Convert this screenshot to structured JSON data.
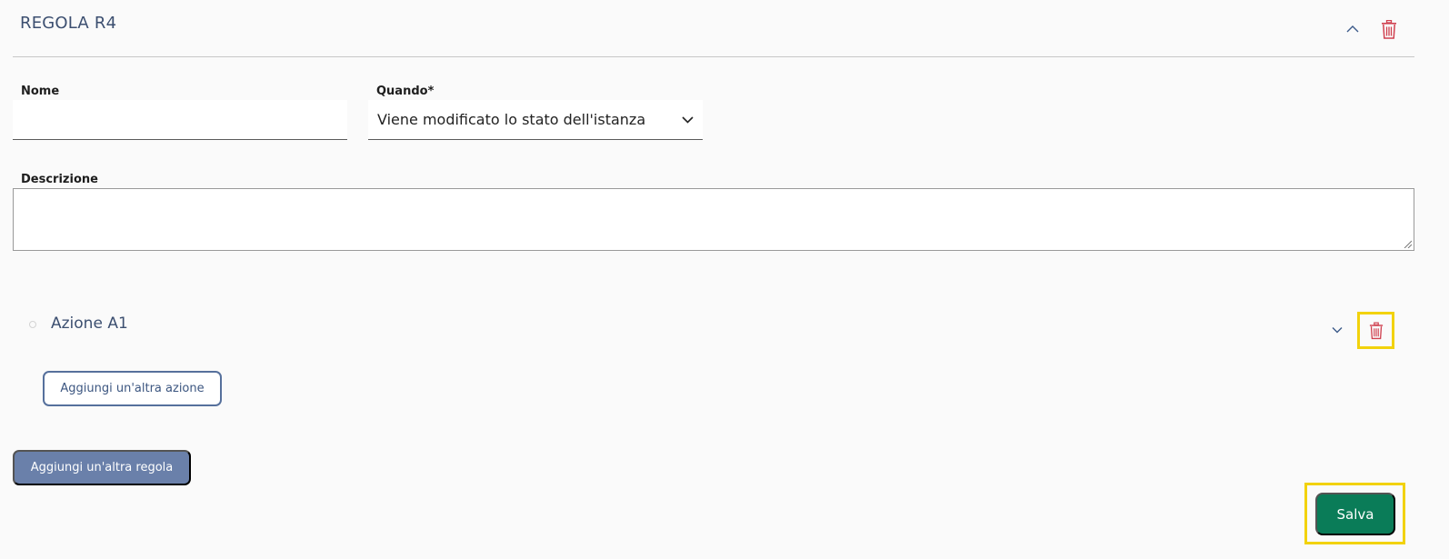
{
  "rule": {
    "title": "REGOLA R4",
    "fields": {
      "name_label": "Nome",
      "name_value": "",
      "when_label": "Quando*",
      "when_value": "Viene modificato lo stato dell'istanza",
      "description_label": "Descrizione",
      "description_value": ""
    },
    "action": {
      "title": "Azione A1"
    },
    "add_action_label": "Aggiungi un'altra azione"
  },
  "add_rule_label": "Aggiungi un'altra regola",
  "save_label": "Salva",
  "colors": {
    "accent": "#3c4f70",
    "danger": "#d0404f",
    "save": "#0a7c58",
    "secondary_button": "#6a80aa",
    "highlight": "#f2d20c"
  },
  "icons": {
    "collapse": "chevron-up-icon",
    "expand": "chevron-down-icon",
    "delete": "trash-icon"
  }
}
